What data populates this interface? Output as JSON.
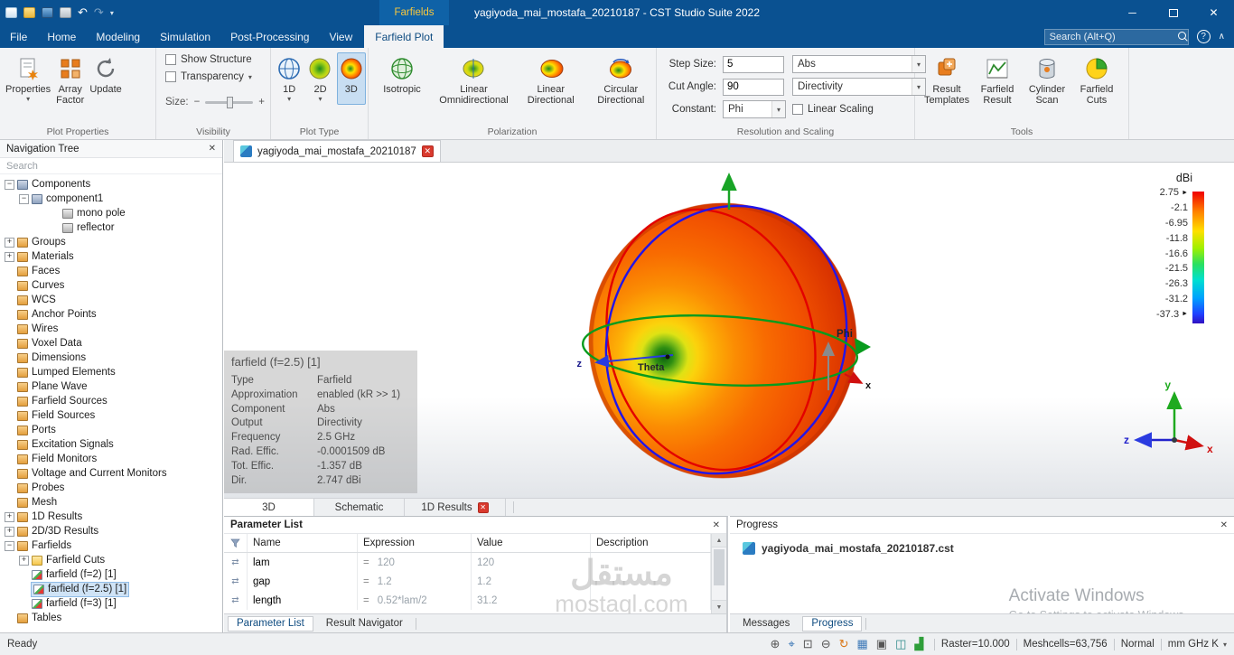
{
  "titlebar": {
    "context_tab": "Farfields",
    "title": "yagiyoda_mai_mostafa_20210187 - CST Studio Suite 2022"
  },
  "menubar": {
    "items": [
      "File",
      "Home",
      "Modeling",
      "Simulation",
      "Post-Processing",
      "View"
    ],
    "active_tab": "Farfield Plot",
    "search_placeholder": "Search (Alt+Q)"
  },
  "ribbon": {
    "plot_properties": {
      "label": "Plot Properties",
      "properties": "Properties",
      "array_factor": "Array\nFactor",
      "update": "Update"
    },
    "visibility": {
      "label": "Visibility",
      "show_structure": "Show Structure",
      "transparency": "Transparency",
      "size": "Size:"
    },
    "plot_type": {
      "label": "Plot Type",
      "d1": "1D",
      "d2": "2D",
      "d3": "3D"
    },
    "polarization": {
      "label": "Polarization",
      "isotropic": "Isotropic",
      "linear_omni": "Linear\nOmnidirectional",
      "linear_dir": "Linear\nDirectional",
      "circular_dir": "Circular\nDirectional"
    },
    "resolution": {
      "label": "Resolution and Scaling",
      "step_size_label": "Step Size:",
      "step_size_value": "5",
      "cut_angle_label": "Cut Angle:",
      "cut_angle_value": "90",
      "constant_label": "Constant:",
      "constant_value": "Phi",
      "abs_value": "Abs",
      "directivity_value": "Directivity",
      "linear_scaling": "Linear Scaling"
    },
    "tools": {
      "label": "Tools",
      "result_templates": "Result\nTemplates",
      "farfield_result": "Farfield\nResult",
      "cylinder_scan": "Cylinder\nScan",
      "farfield_cuts": "Farfield\nCuts"
    }
  },
  "nav": {
    "title": "Navigation Tree",
    "search_placeholder": "Search",
    "items": [
      "Components",
      "component1",
      "mono pole",
      "reflector",
      "Groups",
      "Materials",
      "Faces",
      "Curves",
      "WCS",
      "Anchor Points",
      "Wires",
      "Voxel Data",
      "Dimensions",
      "Lumped Elements",
      "Plane Wave",
      "Farfield Sources",
      "Field Sources",
      "Ports",
      "Excitation Signals",
      "Field Monitors",
      "Voltage and Current Monitors",
      "Probes",
      "Mesh",
      "1D Results",
      "2D/3D Results",
      "Farfields",
      "Farfield Cuts",
      "farfield (f=2) [1]",
      "farfield (f=2.5) [1]",
      "farfield (f=3) [1]",
      "Tables"
    ]
  },
  "doc_tab": "yagiyoda_mai_mostafa_20210187",
  "viewport": {
    "info": {
      "title": "farfield (f=2.5) [1]",
      "rows": [
        {
          "label": "Type",
          "value": "Farfield"
        },
        {
          "label": "Approximation",
          "value": "enabled (kR >> 1)"
        },
        {
          "label": "Component",
          "value": "Abs"
        },
        {
          "label": "Output",
          "value": "Directivity"
        },
        {
          "label": "Frequency",
          "value": "2.5 GHz"
        },
        {
          "label": "Rad. Effic.",
          "value": "-0.0001509 dB"
        },
        {
          "label": "Tot. Effic.",
          "value": "-1.357 dB"
        },
        {
          "label": "Dir.",
          "value": "2.747 dBi"
        }
      ]
    },
    "colorbar": {
      "title": "dBi",
      "ticks": [
        "2.75",
        "-2.1",
        "-6.95",
        "-11.8",
        "-16.6",
        "-21.5",
        "-26.3",
        "-31.2",
        "-37.3"
      ]
    },
    "labels": {
      "phi": "Phi",
      "theta": "Theta",
      "x": "x",
      "y": "y",
      "z": "z"
    }
  },
  "view_tabs": {
    "t3d": "3D",
    "schematic": "Schematic",
    "results1d": "1D Results"
  },
  "params": {
    "title": "Parameter List",
    "headers": [
      "Name",
      "Expression",
      "Value",
      "Description"
    ],
    "eq": "=",
    "rows": [
      {
        "name": "lam",
        "expression": "120",
        "value": "120"
      },
      {
        "name": "gap",
        "expression": "1.2",
        "value": "1.2"
      },
      {
        "name": "length",
        "expression": "0.52*lam/2",
        "value": "31.2"
      }
    ],
    "tabs": [
      "Parameter List",
      "Result Navigator"
    ]
  },
  "progress": {
    "title": "Progress",
    "file": "yagiyoda_mai_mostafa_20210187.cst",
    "tabs": [
      "Messages",
      "Progress"
    ]
  },
  "watermarks": {
    "activate1": "Activate Windows",
    "activate2": "Go to Settings to activate Windows.",
    "mostaql_ar": "مستقل",
    "mostaql_en": "mostaql.com"
  },
  "statusbar": {
    "ready": "Ready",
    "raster": "Raster=10.000",
    "meshcells": "Meshcells=63,756",
    "normal": "Normal",
    "units": "mm GHz K"
  },
  "colors": {
    "titlebar_blue": "#0a5191",
    "context_tab_yellow": "#f8c73c",
    "selection_blue": "#cfe3f6",
    "close_red": "#d93a2e"
  },
  "icons": {
    "minimize": "─",
    "close": "✕",
    "dropdown": "▾",
    "undo": "↶",
    "redo": "↷",
    "help": "?",
    "chevron_up": "∧",
    "panel_close": "✕",
    "tab_close": "✕",
    "scroll_up": "▲",
    "scroll_down": "▼",
    "marker": "►",
    "gutter": "⇄",
    "minus": "−",
    "plus": "+",
    "status_zoom_in": "⊕",
    "status_center": "⌖",
    "status_zoom_box": "⊡",
    "status_zoom_out": "⊖",
    "status_rotate": "↻",
    "status_grid": "▦",
    "status_bbox": "▣",
    "status_cylinder": "◫",
    "status_chart": "▟"
  }
}
